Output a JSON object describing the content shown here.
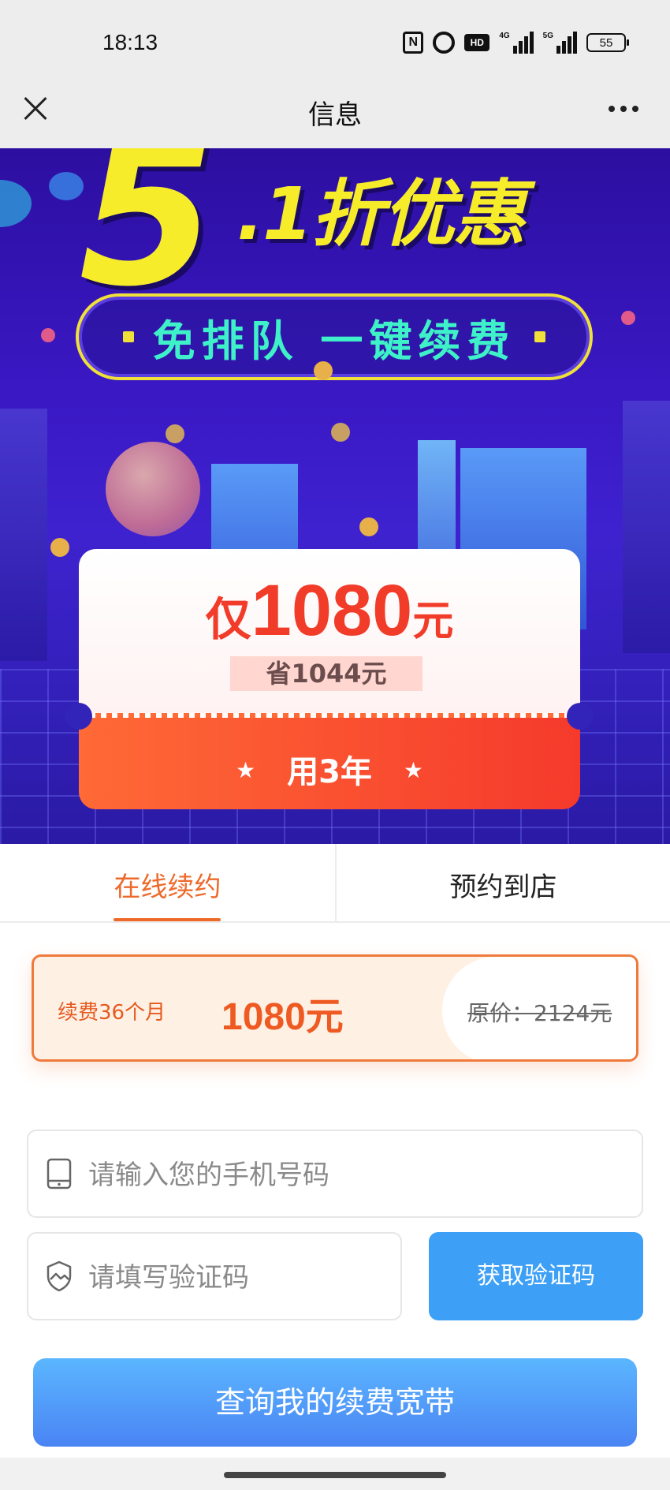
{
  "status_bar": {
    "time": "18:13",
    "nfc": "N",
    "hd": "HD",
    "net1": "4G",
    "net2": "5G",
    "battery": "55"
  },
  "nav": {
    "title": "信息",
    "close_icon": "close-icon",
    "more_icon": "more-icon"
  },
  "banner": {
    "big_number": "5",
    "headline": ".1折优惠",
    "pill_text": "免排队 一键续费",
    "price_prefix": "仅",
    "price_value": "1080",
    "price_unit": "元",
    "save_text": "省1044元",
    "years_text": "用3年",
    "star": "★",
    "colors": {
      "yellow": "#f7ec2a",
      "teal": "#3ef1c8",
      "red": "#f23c2a",
      "bg": "#3a18c4"
    }
  },
  "tabs": [
    {
      "label": "在线续约",
      "active": true
    },
    {
      "label": "预约到店",
      "active": false
    }
  ],
  "plan": {
    "label": "续费36个月",
    "price": "1080元",
    "original_price": "原价：2124元"
  },
  "form": {
    "phone_placeholder": "请输入您的手机号码",
    "phone_value": "",
    "code_placeholder": "请填写验证码",
    "code_value": "",
    "get_code_label": "获取验证码",
    "query_label": "查询我的续费宽带"
  },
  "accent": {
    "orange": "#ee6a2a",
    "blue": "#3da0f6"
  }
}
